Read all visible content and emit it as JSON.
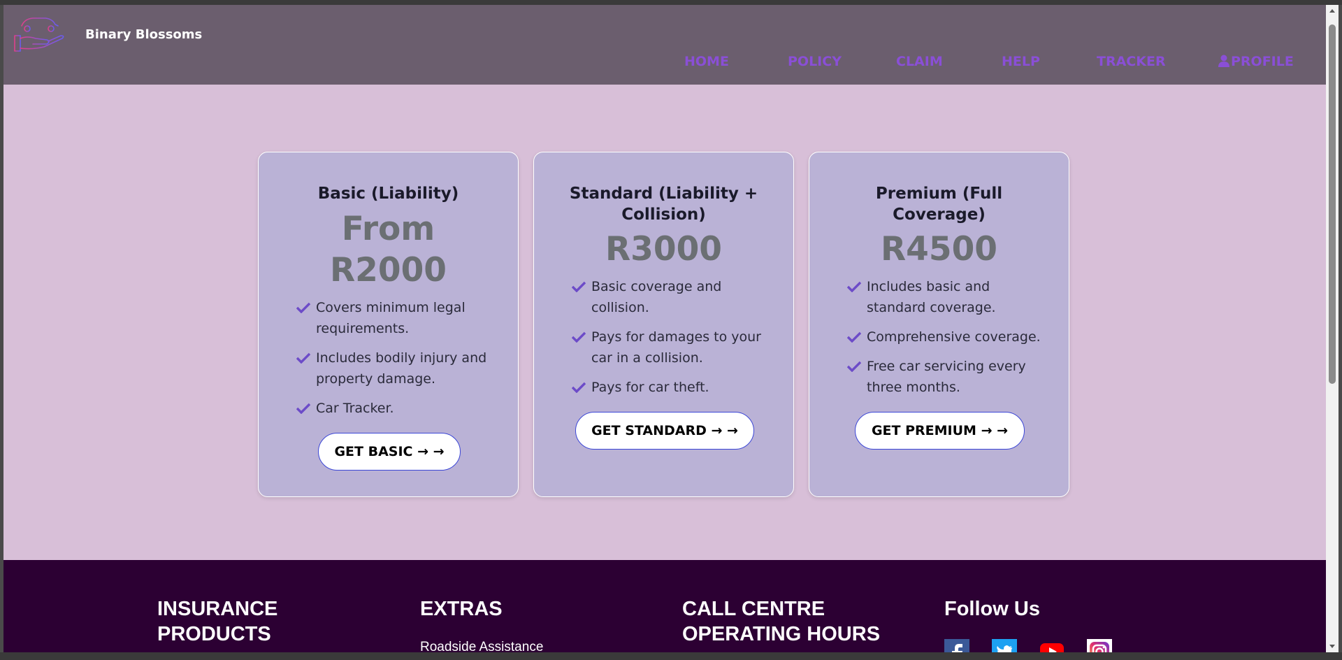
{
  "brand": {
    "name": "Binary Blossoms",
    "logo_icon": "hand-car-logo"
  },
  "nav": [
    {
      "label": "HOME"
    },
    {
      "label": "POLICY"
    },
    {
      "label": "CLAIM"
    },
    {
      "label": "HELP"
    },
    {
      "label": "TRACKER"
    },
    {
      "label": "PROFILE",
      "icon": "user-icon"
    }
  ],
  "plans": [
    {
      "title": "Basic (Liability)",
      "price_line1": "From",
      "price_line2": "R2000",
      "features": [
        "Covers minimum legal requirements.",
        "Includes bodily injury and property damage.",
        "Car Tracker."
      ],
      "cta": "GET BASIC → →"
    },
    {
      "title_line1": "Standard (Liability +",
      "title_line2": "Collision)",
      "price": "R3000",
      "features": [
        "Basic coverage and collision.",
        "Pays for damages to your car in a collision.",
        "Pays for car theft."
      ],
      "cta": "GET STANDARD → →"
    },
    {
      "title_line1": "Premium (Full",
      "title_line2": "Coverage)",
      "price": "R4500",
      "features": [
        "Includes basic and standard coverage.",
        "Comprehensive coverage.",
        "Free car servicing every three months."
      ],
      "cta": "GET PREMIUM → →"
    }
  ],
  "footer": {
    "col1_line1": "INSURANCE",
    "col1_line2": "PRODUCTS",
    "col2": "EXTRAS",
    "col2_link": "Roadside Assistance",
    "col3_line1": "CALL CENTRE",
    "col3_line2": "OPERATING HOURS",
    "col4": "Follow Us",
    "social": [
      "facebook-icon",
      "twitter-icon",
      "youtube-icon",
      "instagram-icon"
    ]
  },
  "colors": {
    "header_bg": "#6b5e6e",
    "nav_accent": "#8a4fd6",
    "page_bg": "#d8bfd8",
    "card_bg": "#bab2d6",
    "footer_bg": "#2c0033"
  }
}
